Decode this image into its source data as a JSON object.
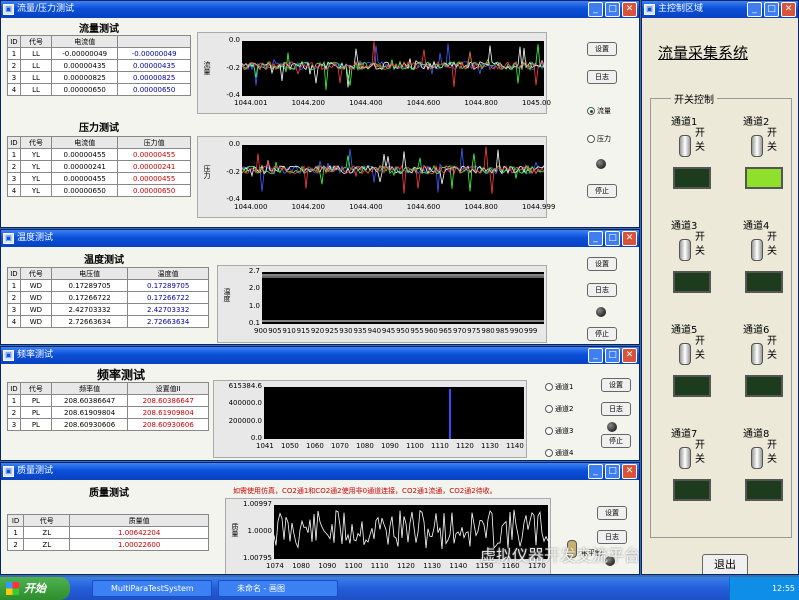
{
  "win1": {
    "title": "流量/压力测试",
    "flow_title": "流量测试",
    "flow_headers": [
      "ID",
      "代号",
      "电流值",
      ""
    ],
    "flow_rows": [
      [
        "1",
        "LL",
        "-0.00000049",
        "-0.00000049"
      ],
      [
        "2",
        "LL",
        "0.00000435",
        "0.00000435"
      ],
      [
        "3",
        "LL",
        "0.00000825",
        "0.00000825"
      ],
      [
        "4",
        "LL",
        "0.00000650",
        "0.00000650"
      ]
    ],
    "flow_y_ticks": [
      "0.0",
      "-0.2",
      "-0.4"
    ],
    "flow_ylabel": "流量",
    "flow_x_ticks": [
      "1044.001",
      "1044.200",
      "1044.400",
      "1044.600",
      "1044.800",
      "1045.00"
    ],
    "press_title": "压力测试",
    "press_headers": [
      "ID",
      "代号",
      "电流值",
      "压力值"
    ],
    "press_rows": [
      [
        "1",
        "YL",
        "0.00000455",
        "0.00000455"
      ],
      [
        "2",
        "YL",
        "0.00000241",
        "0.00000241"
      ],
      [
        "3",
        "YL",
        "0.00000455",
        "0.00000455"
      ],
      [
        "4",
        "YL",
        "0.00000650",
        "0.00000650"
      ]
    ],
    "press_y_ticks": [
      "0.0",
      "-0.2",
      "-0.4"
    ],
    "press_ylabel": "压力",
    "press_x_ticks": [
      "1044.000",
      "1044.200",
      "1044.400",
      "1044.600",
      "1044.800",
      "1044.999"
    ],
    "btn_settings": "设置",
    "btn_log": "日志",
    "radio_flow": "流量",
    "radio_pressure": "压力",
    "btn_stop": "停止"
  },
  "win2": {
    "title": "温度测试",
    "hdr": "温度测试",
    "headers": [
      "ID",
      "代号",
      "电压值",
      "温度值"
    ],
    "rows": [
      [
        "1",
        "WD",
        "0.17289705",
        "0.17289705"
      ],
      [
        "2",
        "WD",
        "0.17266722",
        "0.17266722"
      ],
      [
        "3",
        "WD",
        "2.42703332",
        "2.42703332"
      ],
      [
        "4",
        "WD",
        "2.72663634",
        "2.72663634"
      ]
    ],
    "y_ticks": [
      "2.7",
      "2.0",
      "1.0",
      "0.1"
    ],
    "ylabel": "温度",
    "x_ticks": [
      "900",
      "905",
      "910",
      "915",
      "920",
      "925",
      "930",
      "935",
      "940",
      "945",
      "950",
      "955",
      "960",
      "965",
      "970",
      "975",
      "980",
      "985",
      "990",
      "999"
    ],
    "btn_settings": "设置",
    "btn_log": "日志",
    "btn_stop": "停止"
  },
  "win3": {
    "title": "频率测试",
    "hdr": "频率测试",
    "headers": [
      "ID",
      "代号",
      "频率值",
      "设置值II"
    ],
    "rows": [
      [
        "1",
        "PL",
        "208.60386647",
        "208.60386647"
      ],
      [
        "2",
        "PL",
        "208.61909804",
        "208.61909804"
      ],
      [
        "3",
        "PL",
        "208.60930606",
        "208.60930606"
      ]
    ],
    "y_ticks": [
      "615384.6",
      "400000.0",
      "200000.0",
      "0.0"
    ],
    "x_ticks": [
      "1041",
      "1050",
      "1060",
      "1070",
      "1080",
      "1090",
      "1100",
      "1110",
      "1120",
      "1130",
      "1140"
    ],
    "radios": [
      "通道1",
      "通道2",
      "通道3",
      "通道4"
    ],
    "btn_settings": "设置",
    "btn_log": "日志",
    "btn_stop": "停止"
  },
  "win4": {
    "title": "质量测试",
    "hdr": "质量测试",
    "notice": "如需使用仿真，CO2通1和CO2通2使用非0通道连接，CO2通1流通，CO2通2待收。",
    "headers": [
      "ID",
      "代号",
      "质量值"
    ],
    "rows": [
      [
        "1",
        "ZL",
        "1.00642204"
      ],
      [
        "2",
        "ZL",
        "1.00022600"
      ]
    ],
    "y_ticks": [
      "1.00997",
      "1.0000",
      "1.00795"
    ],
    "ylabel": "质量",
    "x_ticks": [
      "1074",
      "1080",
      "1090",
      "1100",
      "1110",
      "1120",
      "1130",
      "1140",
      "1150",
      "1160",
      "1170"
    ],
    "btn_settings": "设置",
    "btn_log": "日志",
    "label_level": "电平制",
    "btn_stop": "停止"
  },
  "main": {
    "title": "主控制区域",
    "system_title": "流量采集系统",
    "group_label": "开关控制",
    "on_label": "开",
    "off_label": "关",
    "channels": [
      {
        "label": "通道1",
        "on": false
      },
      {
        "label": "通道2",
        "on": true
      },
      {
        "label": "通道3",
        "on": false
      },
      {
        "label": "通道4",
        "on": false
      },
      {
        "label": "通道5",
        "on": false
      },
      {
        "label": "通道6",
        "on": false
      },
      {
        "label": "通道7",
        "on": false
      },
      {
        "label": "通道8",
        "on": false
      }
    ],
    "exit_label": "退出"
  },
  "taskbar": {
    "start": "开始",
    "tasks": [
      "MultiParaTestSystem",
      "未命名 - 画图"
    ],
    "clock": "12:55"
  },
  "watermark": "虚拟仪器开发交流平台",
  "colors": {
    "titlebar": "#0a4fd8",
    "led_on": "#8fe02a",
    "led_off": "#1d3b1d",
    "plot_bg": "#000000"
  }
}
